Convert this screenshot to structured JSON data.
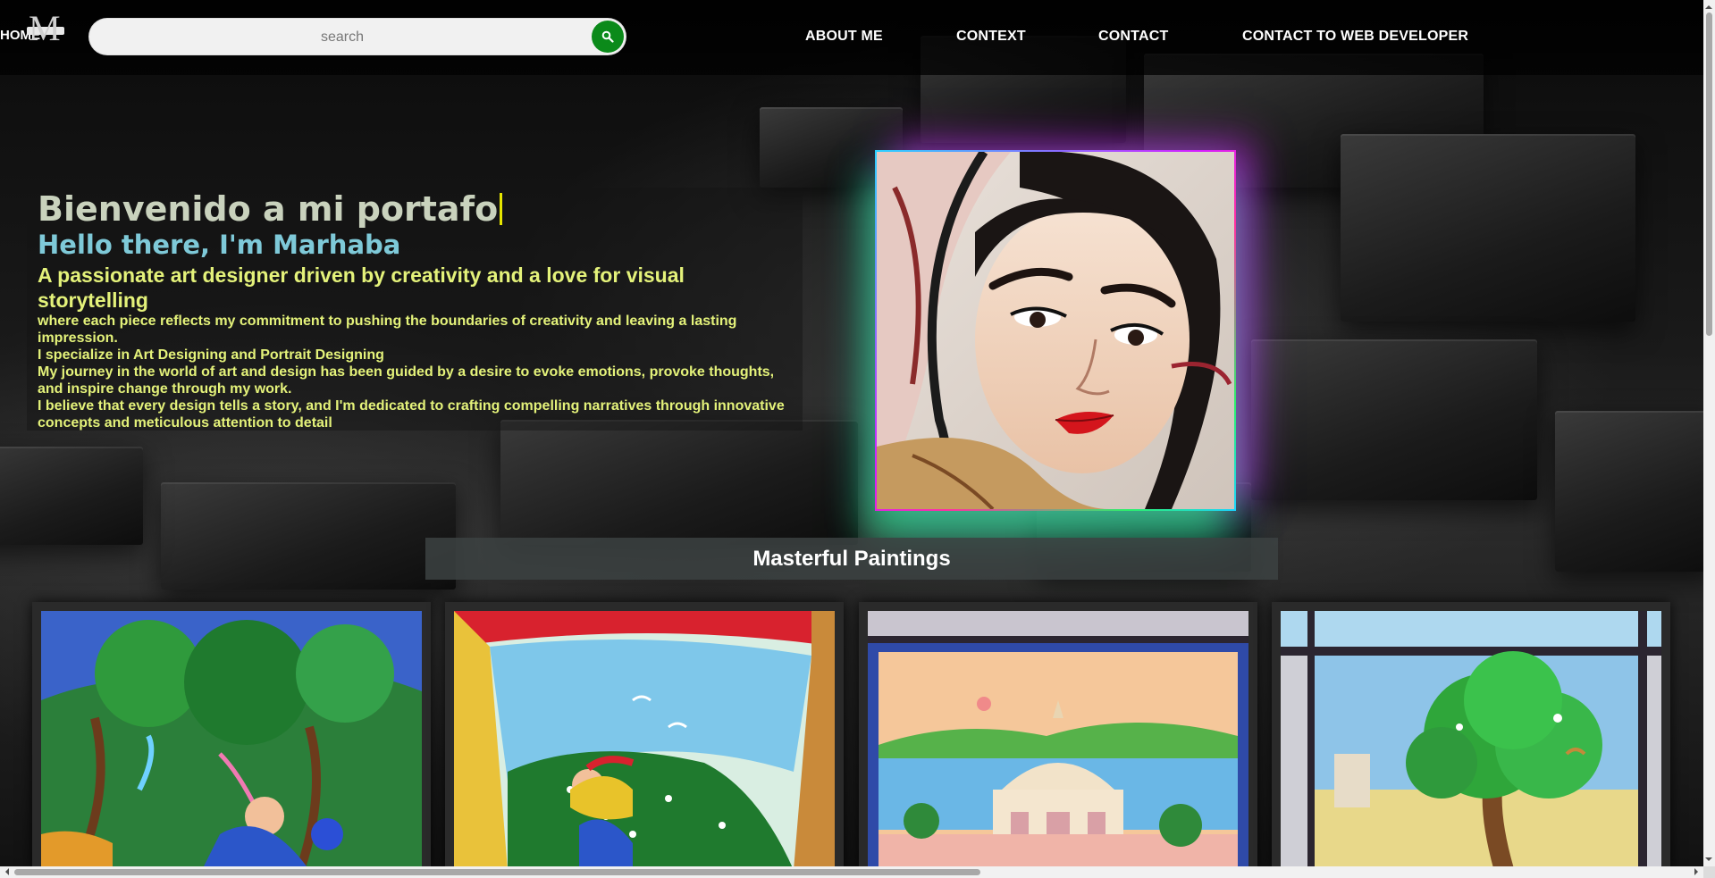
{
  "header": {
    "home_label": "HOME",
    "search_placeholder": "search",
    "nav": [
      {
        "label": "ABOUT ME"
      },
      {
        "label": "CONTEXT"
      },
      {
        "label": "CONTACT"
      },
      {
        "label": "CONTACT TO WEB DEVELOPER"
      }
    ]
  },
  "hero": {
    "heading": "Bienvenido a mi portafo",
    "greeting": "Hello there, I'm Marhaba",
    "tagline": "A passionate art designer driven by creativity and a love for visual storytelling",
    "paragraphs": [
      "where each piece reflects my commitment to pushing the boundaries of creativity and leaving a lasting impression.",
      "I specialize in Art Designing and Portrait Designing",
      "My journey in the world of art and design has been guided by a desire to evoke emotions, provoke thoughts, and inspire change through my work.",
      "I believe that every design tells a story, and I'm dedicated to crafting compelling narratives through innovative concepts and meticulous attention to detail"
    ]
  },
  "gallery": {
    "title": "Masterful Paintings"
  },
  "colors": {
    "search_button": "#0b8a1a",
    "heading": "#c9d2bd",
    "greeting": "#7ec9d8",
    "body_text": "#e4f27a"
  },
  "icons": {
    "search_button": "search-icon"
  }
}
